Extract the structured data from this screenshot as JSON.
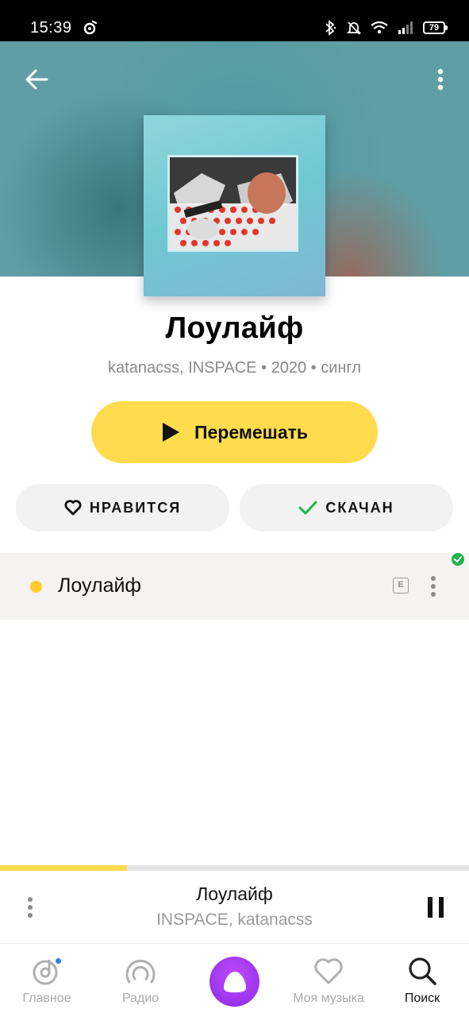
{
  "status_bar": {
    "time": "15:39",
    "battery": "79",
    "icons": [
      "bluetooth-icon",
      "mute-icon",
      "wifi-icon",
      "signal-icon",
      "battery-icon"
    ]
  },
  "header": {
    "back_icon": "arrow-left-icon",
    "more_icon": "more-vertical-icon"
  },
  "album": {
    "title": "Лоулайф",
    "meta": "katanacss, INSPACE • 2020 • сингл",
    "shuffle_label": "Перемешать",
    "like_label": "НРАВИТСЯ",
    "downloaded_label": "СКАЧАН"
  },
  "tracks": [
    {
      "title": "Лоулайф",
      "explicit_badge": "E",
      "downloaded": true
    }
  ],
  "player": {
    "title": "Лоулайф",
    "artist": "INSPACE, katanacss",
    "progress": 0.27
  },
  "bottom_nav": {
    "items": [
      {
        "label": "Главное",
        "icon": "music-note-icon",
        "active": false
      },
      {
        "label": "Радио",
        "icon": "radio-icon",
        "active": false
      },
      {
        "label": "",
        "icon": "alice-icon",
        "active": false
      },
      {
        "label": "Моя музыка",
        "icon": "heart-icon",
        "active": false
      },
      {
        "label": "Поиск",
        "icon": "search-icon",
        "active": true
      }
    ]
  },
  "colors": {
    "accent": "#ffdb4d",
    "track_dot": "#ffcc2e",
    "downloaded_check": "#1fb44c",
    "alice": "#8a2be2"
  }
}
